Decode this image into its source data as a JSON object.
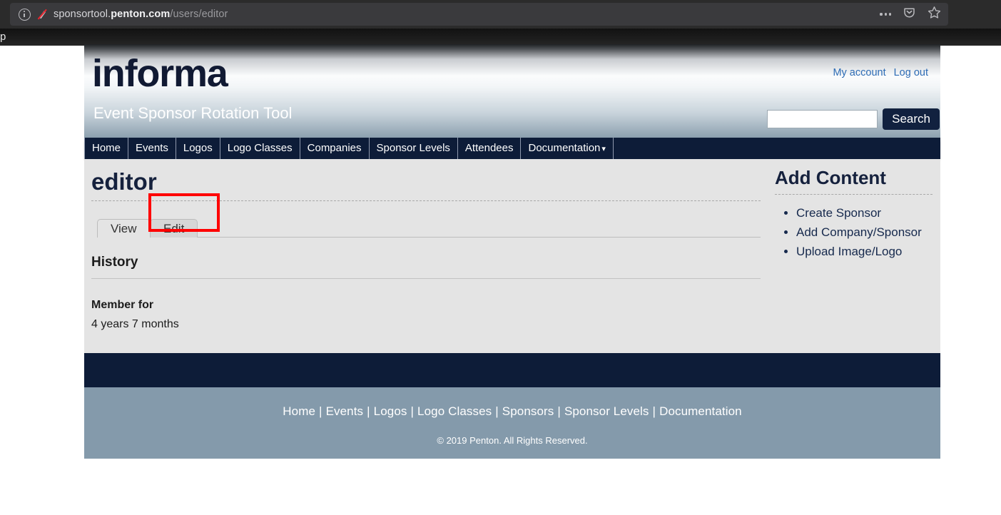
{
  "browser": {
    "url_prefix": "sponsortool.",
    "url_host": "penton.com",
    "url_path": "/users/editor",
    "icons": {
      "info": "info-icon",
      "blocked_pencil": "no-edit-icon",
      "ellipsis": "ellipsis-icon",
      "pocket": "pocket-shield-icon",
      "bookmark": "star-icon"
    },
    "tab_strip_glyph": "p"
  },
  "header": {
    "logo": "informa",
    "tagline": "Event Sponsor Rotation Tool",
    "account_links": [
      {
        "label": "My account"
      },
      {
        "label": "Log out"
      }
    ],
    "search": {
      "value": "",
      "placeholder": "",
      "button_label": "Search"
    }
  },
  "nav": {
    "items": [
      {
        "label": "Home",
        "caret": false
      },
      {
        "label": "Events",
        "caret": false
      },
      {
        "label": "Logos",
        "caret": false
      },
      {
        "label": "Logo Classes",
        "caret": false
      },
      {
        "label": "Companies",
        "caret": false
      },
      {
        "label": "Sponsor Levels",
        "caret": false
      },
      {
        "label": "Attendees",
        "caret": false
      },
      {
        "label": "Documentation",
        "caret": true
      }
    ],
    "caret_glyph": "▾"
  },
  "main": {
    "page_title": "editor",
    "tabs": [
      {
        "label": "View",
        "active": true
      },
      {
        "label": "Edit",
        "active": false,
        "highlighted": true
      }
    ],
    "history": {
      "heading": "History",
      "member_for_label": "Member for",
      "member_for_value": "4 years 7 months"
    }
  },
  "sidebar": {
    "title": "Add Content",
    "items": [
      {
        "label": "Create Sponsor"
      },
      {
        "label": "Add Company/Sponsor"
      },
      {
        "label": "Upload Image/Logo"
      }
    ]
  },
  "footer": {
    "links": [
      {
        "label": "Home"
      },
      {
        "label": "Events"
      },
      {
        "label": "Logos"
      },
      {
        "label": "Logo Classes"
      },
      {
        "label": "Sponsors"
      },
      {
        "label": "Sponsor Levels"
      },
      {
        "label": "Documentation"
      }
    ],
    "separator": "|",
    "copyright": "© 2019 Penton. All Rights Reserved."
  },
  "colors": {
    "brand_navy": "#0d1c38",
    "link_blue": "#2d6cb5",
    "content_gray": "#e4e4e4",
    "footer_slate": "#849aab",
    "highlight_red": "#ff0000"
  }
}
